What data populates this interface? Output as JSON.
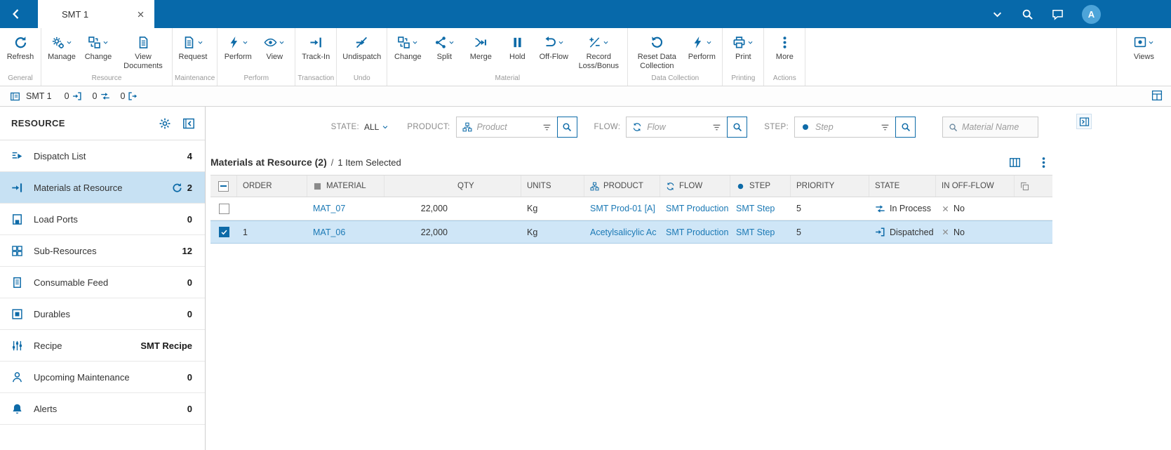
{
  "topbar": {
    "tab_title": "SMT 1",
    "avatar_initial": "A"
  },
  "ribbon": {
    "views_label": "Views",
    "groups": [
      {
        "label": "General",
        "buttons": [
          {
            "label": "Refresh",
            "icon": "refresh",
            "dropdown": false
          }
        ]
      },
      {
        "label": "Resource",
        "buttons": [
          {
            "label": "Manage",
            "icon": "gears",
            "dropdown": true
          },
          {
            "label": "Change",
            "icon": "swap",
            "dropdown": true
          },
          {
            "label": "View Documents",
            "icon": "document",
            "dropdown": false
          }
        ]
      },
      {
        "label": "Maintenance",
        "buttons": [
          {
            "label": "Request",
            "icon": "document",
            "dropdown": true
          }
        ]
      },
      {
        "label": "Perform",
        "buttons": [
          {
            "label": "Perform",
            "icon": "lightning",
            "dropdown": true
          },
          {
            "label": "View",
            "icon": "eye",
            "dropdown": true
          }
        ]
      },
      {
        "label": "Transaction",
        "buttons": [
          {
            "label": "Track-In",
            "icon": "track-in",
            "dropdown": false
          }
        ]
      },
      {
        "label": "Undo",
        "buttons": [
          {
            "label": "Undispatch",
            "icon": "undispatch",
            "dropdown": false
          }
        ]
      },
      {
        "label": "Material",
        "buttons": [
          {
            "label": "Change",
            "icon": "swap",
            "dropdown": true
          },
          {
            "label": "Split",
            "icon": "split",
            "dropdown": true
          },
          {
            "label": "Merge",
            "icon": "merge",
            "dropdown": false
          },
          {
            "label": "Hold",
            "icon": "hold",
            "dropdown": false
          },
          {
            "label": "Off-Flow",
            "icon": "off-flow",
            "dropdown": true
          },
          {
            "label": "Record Loss/Bonus",
            "icon": "plus-minus",
            "dropdown": true
          }
        ]
      },
      {
        "label": "Data Collection",
        "buttons": [
          {
            "label": "Reset Data Collection",
            "icon": "reset",
            "dropdown": false
          },
          {
            "label": "Perform",
            "icon": "lightning",
            "dropdown": true
          }
        ]
      },
      {
        "label": "Printing",
        "buttons": [
          {
            "label": "Print",
            "icon": "printer",
            "dropdown": true
          }
        ]
      },
      {
        "label": "Actions",
        "buttons": [
          {
            "label": "More",
            "icon": "dots-v",
            "dropdown": false
          }
        ]
      }
    ]
  },
  "context_bar": {
    "resource_name": "SMT 1",
    "counters": [
      {
        "value": "0",
        "icon": "dispatched"
      },
      {
        "value": "0",
        "icon": "in-process"
      },
      {
        "value": "0",
        "icon": "track-out"
      }
    ]
  },
  "sidebar": {
    "title": "RESOURCE",
    "items": [
      {
        "label": "Dispatch List",
        "icon": "dispatch-list",
        "count": "4",
        "selected": false,
        "auto_refresh": false
      },
      {
        "label": "Materials at Resource",
        "icon": "track-in",
        "count": "2",
        "selected": true,
        "auto_refresh": true
      },
      {
        "label": "Load Ports",
        "icon": "load-ports",
        "count": "0",
        "selected": false,
        "auto_refresh": false
      },
      {
        "label": "Sub-Resources",
        "icon": "sub-resources",
        "count": "12",
        "selected": false,
        "auto_refresh": false
      },
      {
        "label": "Consumable Feed",
        "icon": "consumable",
        "count": "0",
        "selected": false,
        "auto_refresh": false
      },
      {
        "label": "Durables",
        "icon": "durables",
        "count": "0",
        "selected": false,
        "auto_refresh": false
      },
      {
        "label": "Recipe",
        "icon": "recipe",
        "count": "SMT Recipe",
        "selected": false,
        "auto_refresh": false
      },
      {
        "label": "Upcoming Maintenance",
        "icon": "person",
        "count": "0",
        "selected": false,
        "auto_refresh": false
      },
      {
        "label": "Alerts",
        "icon": "bell",
        "count": "0",
        "selected": false,
        "auto_refresh": false
      }
    ]
  },
  "filters": {
    "state_label": "STATE:",
    "state_value": "ALL",
    "product_label": "PRODUCT:",
    "product_placeholder": "Product",
    "flow_label": "FLOW:",
    "flow_placeholder": "Flow",
    "step_label": "STEP:",
    "step_placeholder": "Step",
    "material_search_placeholder": "Material Name"
  },
  "grid": {
    "title": "Materials at Resource (2)",
    "separator": "/",
    "selection_text": "1 Item Selected",
    "columns": [
      {
        "field": "order",
        "label": "ORDER"
      },
      {
        "field": "material",
        "label": "MATERIAL"
      },
      {
        "field": "qty",
        "label": "QTY"
      },
      {
        "field": "units",
        "label": "UNITS"
      },
      {
        "field": "product",
        "label": "PRODUCT"
      },
      {
        "field": "flow",
        "label": "FLOW"
      },
      {
        "field": "step",
        "label": "STEP"
      },
      {
        "field": "priority",
        "label": "PRIORITY"
      },
      {
        "field": "state",
        "label": "STATE"
      },
      {
        "field": "in_off_flow",
        "label": "IN OFF-FLOW"
      }
    ],
    "rows": [
      {
        "checked": false,
        "selected": false,
        "order": "",
        "material": "MAT_07",
        "qty": "22,000",
        "units": "Kg",
        "product": "SMT Prod-01 [A]",
        "flow": "SMT Production",
        "step": "SMT Step",
        "priority": "5",
        "state": "In Process",
        "state_icon": "in-process",
        "in_off_flow": "No"
      },
      {
        "checked": true,
        "selected": true,
        "order": "1",
        "material": "MAT_06",
        "qty": "22,000",
        "units": "Kg",
        "product": "Acetylsalicylic Ac",
        "flow": "SMT Production",
        "step": "SMT Step",
        "priority": "5",
        "state": "Dispatched",
        "state_icon": "dispatched",
        "in_off_flow": "No"
      }
    ]
  }
}
